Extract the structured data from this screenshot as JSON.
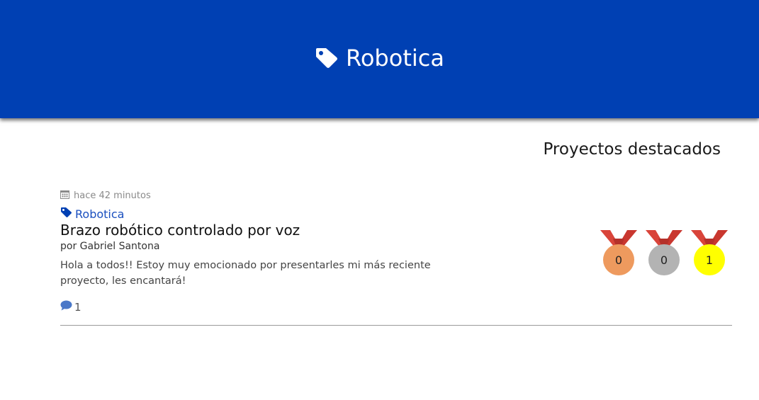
{
  "banner": {
    "title": "Robotica",
    "icon": "tag-icon",
    "background": "#0040b3"
  },
  "section": {
    "title": "Proyectos destacados"
  },
  "post": {
    "date": "hace 42 minutos",
    "date_icon": "calendar-icon",
    "tag": "Robotica",
    "tag_icon": "tag-icon",
    "title": "Brazo robótico controlado por voz",
    "author": "por Gabriel Santona",
    "excerpt": "Hola a todos!! Estoy muy emocionado por presentarles mi más reciente proyecto, les encantará!",
    "comments_count": "1",
    "comments_icon": "comment-icon"
  },
  "medals": [
    {
      "kind": "bronze",
      "count": "0",
      "color": "#ee9a5e",
      "ribbon": "#d9443a"
    },
    {
      "kind": "silver",
      "count": "0",
      "color": "#b3b3b3",
      "ribbon": "#d9443a"
    },
    {
      "kind": "gold",
      "count": "1",
      "color": "#ffff00",
      "ribbon": "#d9443a"
    }
  ]
}
